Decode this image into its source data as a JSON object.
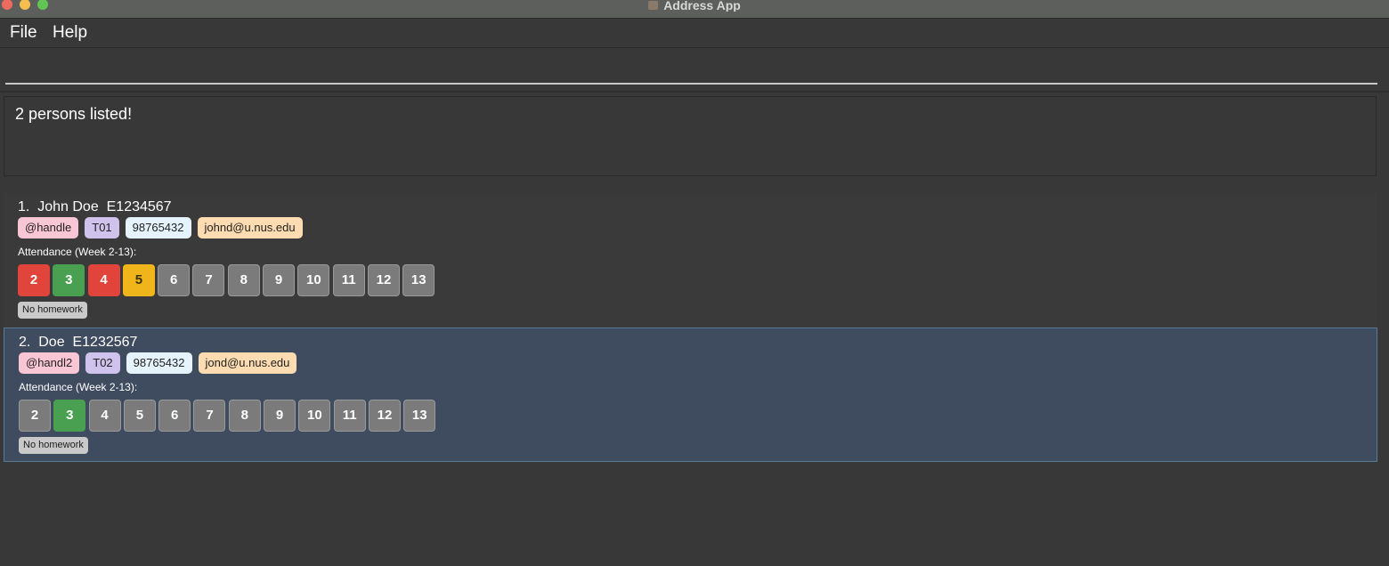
{
  "window": {
    "title": "Address App"
  },
  "menu": {
    "file": "File",
    "help": "Help"
  },
  "command": {
    "value": "",
    "placeholder": ""
  },
  "result": {
    "text": "2 persons listed!"
  },
  "persons": [
    {
      "title": "1.  John Doe  E1234567",
      "handle": "@handle",
      "tutorial": "T01",
      "phone": "98765432",
      "email": "johnd@u.nus.edu",
      "attendance_label": "Attendance (Week 2-13):",
      "weeks": [
        "2",
        "3",
        "4",
        "5",
        "6",
        "7",
        "8",
        "9",
        "10",
        "11",
        "12",
        "13"
      ],
      "week_status": [
        "absent",
        "present",
        "absent",
        "excused",
        "none",
        "none",
        "none",
        "none",
        "none",
        "none",
        "none",
        "none"
      ],
      "homework": "No homework",
      "selected": false
    },
    {
      "title": "2.  Doe  E1232567",
      "handle": "@handl2",
      "tutorial": "T02",
      "phone": "98765432",
      "email": "jond@u.nus.edu",
      "attendance_label": "Attendance (Week 2-13):",
      "weeks": [
        "2",
        "3",
        "4",
        "5",
        "6",
        "7",
        "8",
        "9",
        "10",
        "11",
        "12",
        "13"
      ],
      "week_status": [
        "none",
        "present",
        "none",
        "none",
        "none",
        "none",
        "none",
        "none",
        "none",
        "none",
        "none",
        "none"
      ],
      "homework": "No homework",
      "selected": true
    }
  ],
  "colors": {
    "absent": "#e0443a",
    "present": "#48a050",
    "excused": "#efb51b",
    "none": "#7b7b7b",
    "selected_card": "#3f4b5e"
  }
}
